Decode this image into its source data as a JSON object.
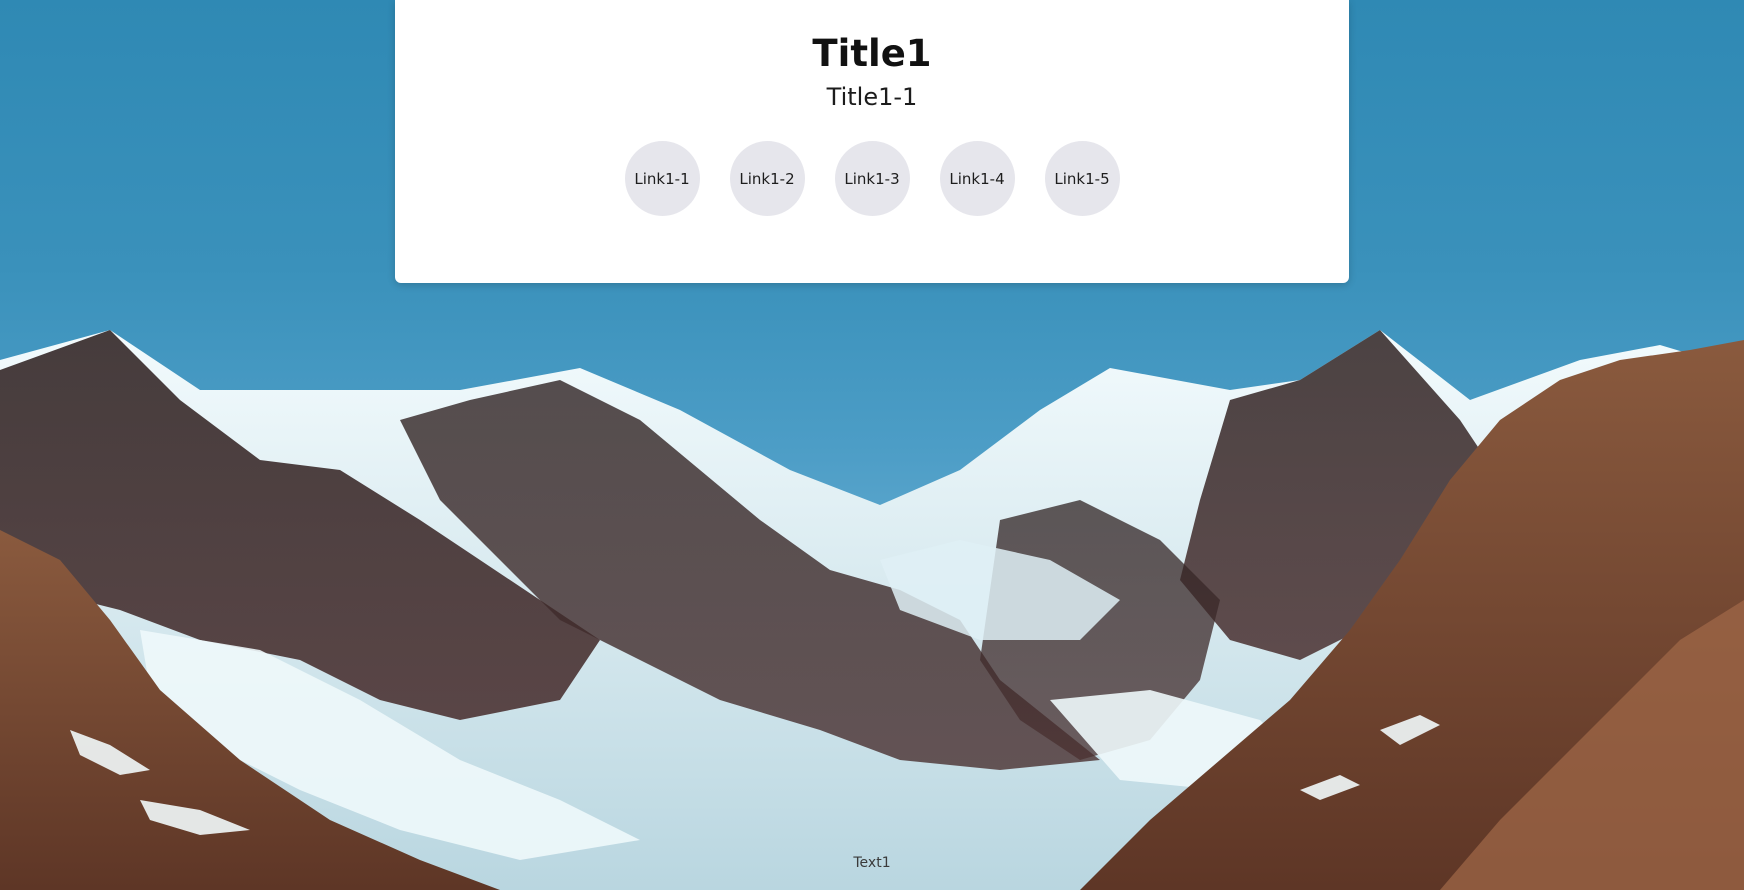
{
  "header": {
    "title": "Title1",
    "subtitle": "Title1-1"
  },
  "links": [
    {
      "label": "Link1-1"
    },
    {
      "label": "Link1-2"
    },
    {
      "label": "Link1-3"
    },
    {
      "label": "Link1-4"
    },
    {
      "label": "Link1-5"
    }
  ],
  "footer": {
    "text": "Text1"
  },
  "colors": {
    "sky": "#2f89b4",
    "card_background": "#ffffff",
    "link_background": "#e6e6ec",
    "snow": "#e4f1f6",
    "rock_dark": "#3a2a2a",
    "rock_brown": "#7a4a32"
  },
  "background": {
    "subject": "snowy-mountain-range-image"
  }
}
